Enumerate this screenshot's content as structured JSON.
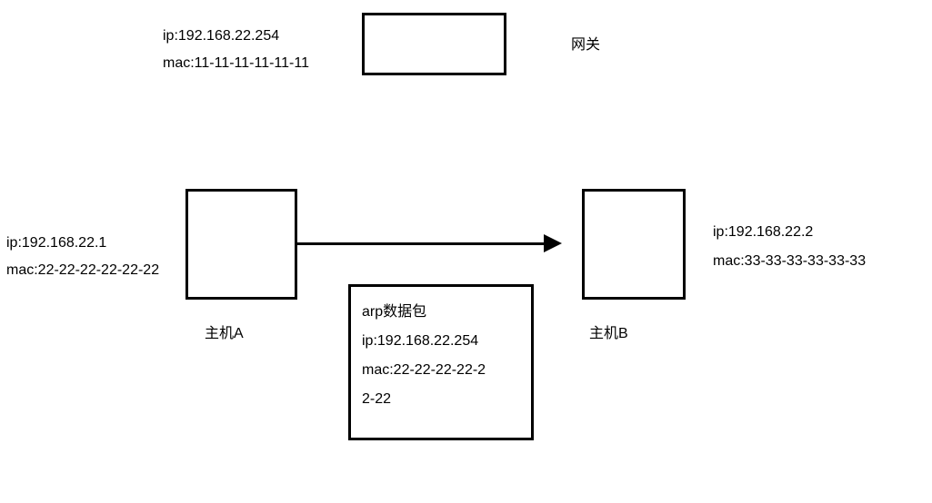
{
  "gateway": {
    "ip_line": "ip:192.168.22.254",
    "mac_line": "mac:11-11-11-11-11-11",
    "label": "网关"
  },
  "hostA": {
    "ip_line": "ip:192.168.22.1",
    "mac_line": "mac:22-22-22-22-22-22",
    "label": "主机A"
  },
  "hostB": {
    "ip_line": "ip:192.168.22.2",
    "mac_line": "mac:33-33-33-33-33-33",
    "label": "主机B"
  },
  "packet": {
    "line1": "arp数据包",
    "line2": "ip:192.168.22.254",
    "line3": "mac:22-22-22-22-2",
    "line4": "2-22"
  }
}
